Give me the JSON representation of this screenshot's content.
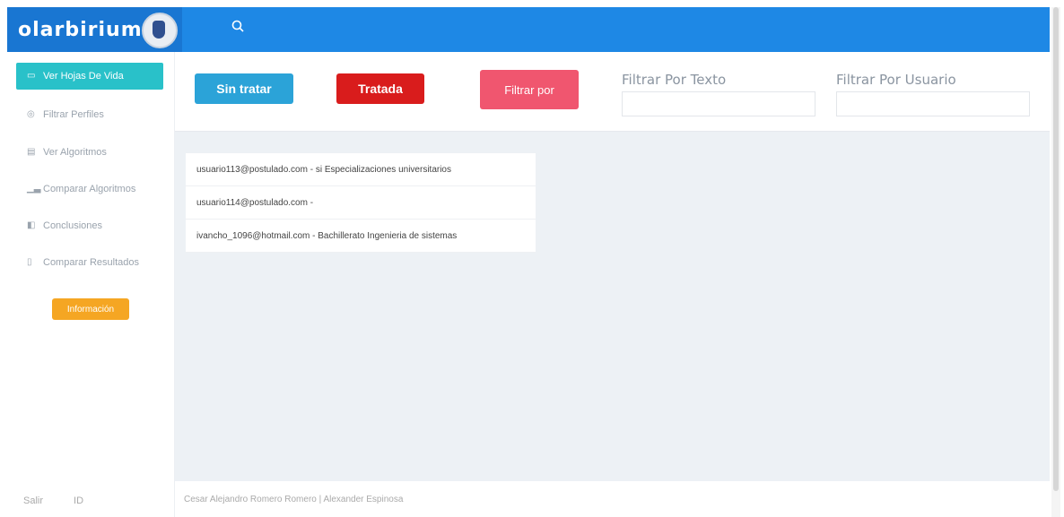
{
  "header": {
    "logo_text": "olarbirium",
    "colors": {
      "topbar": "#1e88e5",
      "accent": "#29c1c9"
    }
  },
  "sidebar": {
    "items": [
      {
        "label": "Ver Hojas De Vida",
        "icon": "id-card-icon"
      },
      {
        "label": "Filtrar Perfiles",
        "icon": "filter-icon"
      },
      {
        "label": "Ver Algoritmos",
        "icon": "calendar-icon"
      },
      {
        "label": "Comparar Algoritmos",
        "icon": "bar-chart-icon"
      },
      {
        "label": "Conclusiones",
        "icon": "panel-icon"
      },
      {
        "label": "Comparar Resultados",
        "icon": "document-icon"
      }
    ],
    "info_button": "Información",
    "footer": {
      "salir": "Salir",
      "id": "ID"
    }
  },
  "toolbar": {
    "sin_tratar": "Sin tratar",
    "tratada": "Tratada",
    "filtrar_por": "Filtrar por",
    "filtro_texto_label": "Filtrar Por Texto",
    "filtro_usuario_label": "Filtrar Por Usuario"
  },
  "results": [
    "usuario113@postulado.com - si Especializaciones universitarios",
    "usuario114@postulado.com -",
    "ivancho_1096@hotmail.com - Bachillerato Ingenieria de sistemas"
  ],
  "footer": {
    "credits": "Cesar Alejandro Romero Romero | Alexander Espinosa"
  }
}
